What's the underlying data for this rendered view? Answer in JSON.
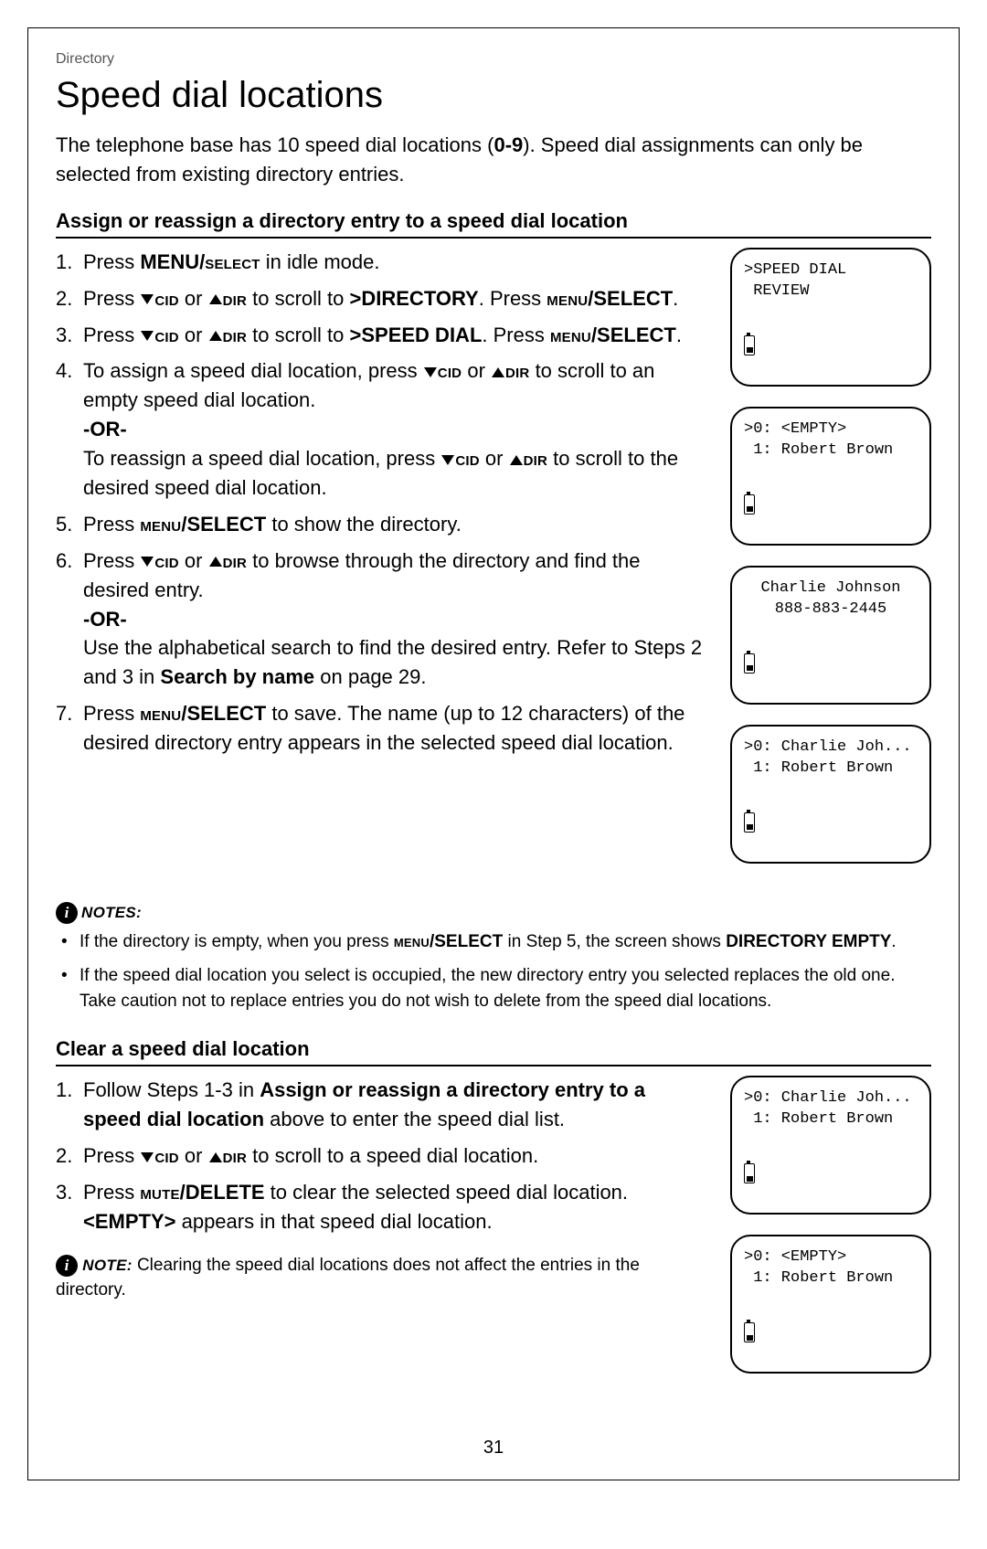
{
  "breadcrumb": "Directory",
  "title": "Speed dial locations",
  "intro_a": "The telephone base has 10 speed dial locations (",
  "intro_bold": "0-9",
  "intro_b": "). Speed dial assignments can only be selected from existing directory entries.",
  "section1_heading": "Assign or reassign a directory entry to a speed dial location",
  "steps1": {
    "s1_a": "Press ",
    "s1_b": "MENU/",
    "s1_c": "select",
    "s1_d": " in idle mode.",
    "s2_a": "Press ",
    "s2_cid": "cid",
    "s2_or": " or ",
    "s2_dir": "dir",
    "s2_b": " to scroll to ",
    "s2_c": ">DIRECTORY",
    "s2_d": ". Press ",
    "s2_e": "menu",
    "s2_f": "/SELECT",
    "s2_g": ".",
    "s3_a": "Press ",
    "s3_b": " to scroll to ",
    "s3_c": ">SPEED DIAL",
    "s3_d": ". Press ",
    "s4_a": "To assign a speed dial location, press ",
    "s4_b": " to scroll to an empty speed dial location.",
    "or": "-OR-",
    "s4_c": "To reassign a speed dial location, press ",
    "s4_d": " to scroll to the desired speed dial location.",
    "s5_a": "Press ",
    "s5_b": " to show the directory.",
    "s6_a": "Press ",
    "s6_b": " to browse through the directory and find the desired entry.",
    "s6_c": "Use the alphabetical search to find the desired entry. Refer to Steps 2 and 3 in ",
    "s6_d": "Search by name",
    "s6_e": " on page 29.",
    "s7_a": "Press ",
    "s7_b": " to save. The name (up to 12 characters) of the desired directory entry appears in the selected speed dial location."
  },
  "notes_label": "NOTES:",
  "notes1": {
    "n1_a": "If the directory is empty, when you press ",
    "n1_b": "menu",
    "n1_c": "/SELECT",
    "n1_d": " in Step 5, the screen shows ",
    "n1_e": "DIRECTORY EMPTY",
    "n1_f": ".",
    "n2": "If the speed dial location you select is occupied, the new directory entry you selected replaces the old one. Take caution not to replace entries you do not wish to delete from the speed dial locations."
  },
  "section2_heading": "Clear a speed dial location",
  "steps2": {
    "s1_a": "Follow Steps 1-3 in ",
    "s1_b": "Assign or reassign a directory entry to a speed dial location",
    "s1_c": " above to enter the speed dial list.",
    "s2_a": "Press ",
    "s2_b": " to scroll to a speed dial location.",
    "s3_a": "Press ",
    "s3_b": "mute",
    "s3_c": "/DELETE",
    "s3_d": " to clear the selected speed dial location. ",
    "s3_e": "<EMPTY>",
    "s3_f": " appears in that speed dial location."
  },
  "note2_label": "NOTE:",
  "note2_text": " Clearing the speed dial locations does not affect the entries in the directory.",
  "screens": {
    "a1": ">SPEED DIAL",
    "a2": " REVIEW",
    "b1": ">0: <EMPTY>",
    "b2": " 1: Robert Brown",
    "c1": "Charlie Johnson",
    "c2": "888-883-2445",
    "d1": ">0: Charlie Joh...",
    "d2": " 1: Robert Brown",
    "e1": ">0: Charlie Joh...",
    "e2": " 1: Robert Brown",
    "f1": ">0: <EMPTY>",
    "f2": " 1: Robert Brown"
  },
  "page_number": "31"
}
